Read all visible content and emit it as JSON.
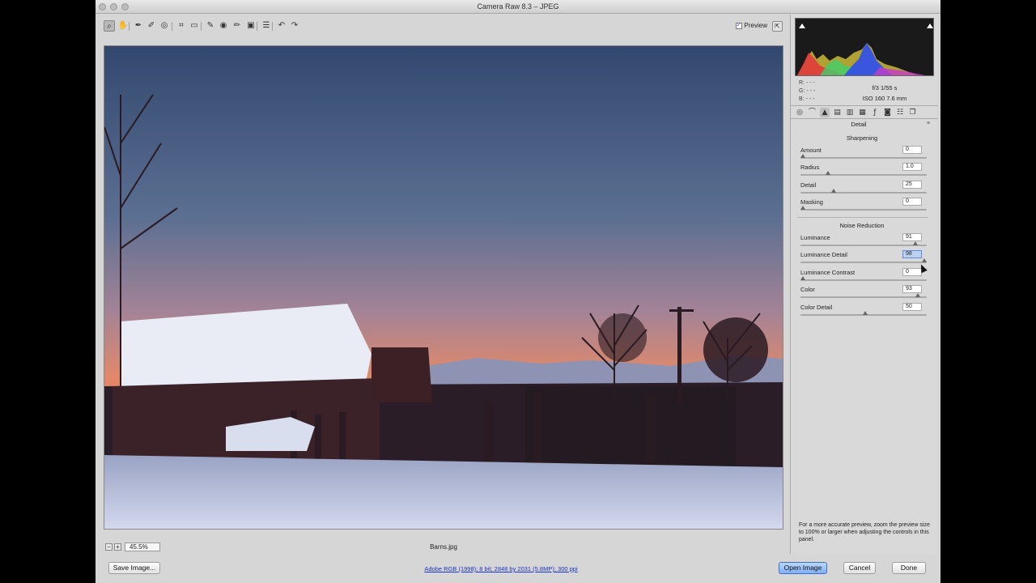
{
  "window": {
    "title": "Camera Raw 8.3  –  JPEG"
  },
  "toolbar": {
    "tools": [
      {
        "icon": "zoom-icon",
        "glyph": "⌕"
      },
      {
        "icon": "hand-icon",
        "glyph": "✋"
      },
      {
        "icon": "white-balance-icon",
        "glyph": "✒"
      },
      {
        "icon": "color-sampler-icon",
        "glyph": "✐"
      },
      {
        "icon": "targeted-adjustment-icon",
        "glyph": "◎"
      },
      {
        "icon": "crop-icon",
        "glyph": "⌗"
      },
      {
        "icon": "straighten-icon",
        "glyph": "▭"
      },
      {
        "icon": "spot-removal-icon",
        "glyph": "✎"
      },
      {
        "icon": "red-eye-icon",
        "glyph": "◉"
      },
      {
        "icon": "adjustment-brush-icon",
        "glyph": "✏"
      },
      {
        "icon": "graduated-filter-icon",
        "glyph": "▣"
      },
      {
        "icon": "preferences-icon",
        "glyph": "☰"
      },
      {
        "icon": "rotate-left-icon",
        "glyph": "↶"
      },
      {
        "icon": "rotate-right-icon",
        "glyph": "↷"
      }
    ],
    "preview_label": "Preview",
    "preview_checked": true
  },
  "histogram": {
    "readout": {
      "r": "R:  - - -",
      "g": "G:  - - -",
      "b": "B:  - - -"
    },
    "exif": {
      "aperture_shutter": "f/3    1/55 s",
      "iso_focal": "ISO 160    7.6 mm"
    }
  },
  "panel": {
    "tabs": [
      "basic-icon",
      "tone-curve-icon",
      "detail-icon",
      "hsl-icon",
      "split-toning-icon",
      "lens-corrections-icon",
      "effects-icon",
      "camera-calibration-icon",
      "presets-icon",
      "snapshots-icon"
    ],
    "title": "Detail",
    "menu_glyph": "≡",
    "sharpening": {
      "heading": "Sharpening",
      "sliders": [
        {
          "label": "Amount",
          "value": "0",
          "fraction": 0.0
        },
        {
          "label": "Radius",
          "value": "1.0",
          "fraction": 0.2
        },
        {
          "label": "Detail",
          "value": "25",
          "fraction": 0.25
        },
        {
          "label": "Masking",
          "value": "0",
          "fraction": 0.0
        }
      ]
    },
    "noise_reduction": {
      "heading": "Noise Reduction",
      "sliders": [
        {
          "label": "Luminance",
          "value": "91",
          "fraction": 0.91
        },
        {
          "label": "Luminance Detail",
          "value": "98",
          "fraction": 0.98,
          "focused": true
        },
        {
          "label": "Luminance Contrast",
          "value": "0",
          "fraction": 0.0
        },
        {
          "label": "Color",
          "value": "93",
          "fraction": 0.93
        },
        {
          "label": "Color Detail",
          "value": "50",
          "fraction": 0.5
        }
      ]
    },
    "note": "For a more accurate preview, zoom the preview size to 100% or larger when adjusting the controls in this panel."
  },
  "status": {
    "zoom": "45.5%",
    "filename": "Barns.jpg"
  },
  "bottom": {
    "save_label": "Save Image...",
    "workflow_link": "Adobe RGB (1998); 8 bit; 2848 by 2031 (5.8MP); 300 ppi",
    "open_label": "Open Image",
    "cancel_label": "Cancel",
    "done_label": "Done"
  }
}
